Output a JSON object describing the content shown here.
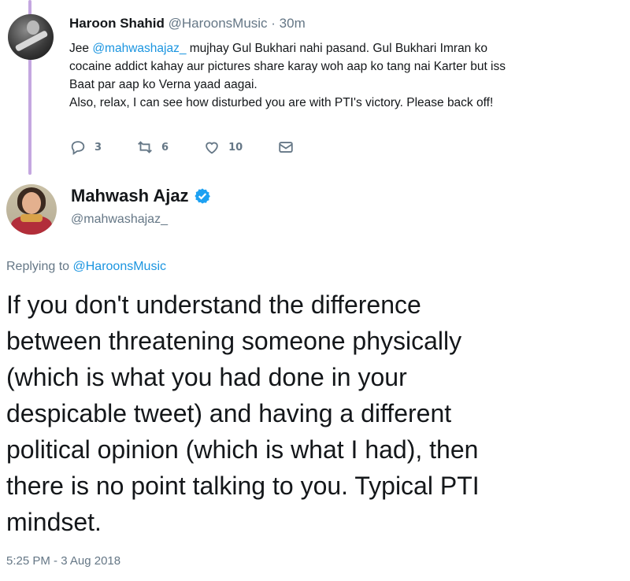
{
  "reply_tweet": {
    "author_name": "Haroon Shahid",
    "author_handle": "@HaroonsMusic",
    "time_ago": "· 30m",
    "body": {
      "line1_prefix": "Jee ",
      "line1_mention": "@mahwashajaz_",
      "line1_suffix": " mujhay Gul Bukhari nahi pasand. Gul Bukhari Imran ko",
      "line2": "cocaine addict kahay aur pictures share karay woh aap ko tang nai Karter but iss",
      "line3": "Baat par aap ko Verna yaad aagai.",
      "line4": "Also, relax, I can see how disturbed you are with PTI's victory. Please back off!"
    },
    "actions": {
      "replies": "3",
      "retweets": "6",
      "likes": "10"
    },
    "icons": [
      "reply-icon",
      "retweet-icon",
      "like-icon",
      "message-icon"
    ]
  },
  "main_tweet": {
    "author_name": "Mahwash Ajaz",
    "author_handle": "@mahwashajaz_",
    "verified_icon": "verified-badge-icon",
    "replying_prefix": "Replying to ",
    "replying_mention": "@HaroonsMusic",
    "text_lines": [
      "If you don't understand the difference",
      "between threatening someone physically",
      "(which is what you had done in your",
      "despicable tweet) and having a different",
      "political opinion (which is what I had), then",
      "there is no point talking to you. Typical PTI",
      "mindset."
    ],
    "timestamp": "5:25 PM - 3 Aug 2018"
  },
  "colors": {
    "link": "#1b95e0",
    "secondary_text": "#657786",
    "primary_text": "#14171a",
    "thread_line": "#c4a7e0",
    "verified": "#1da1f2"
  }
}
